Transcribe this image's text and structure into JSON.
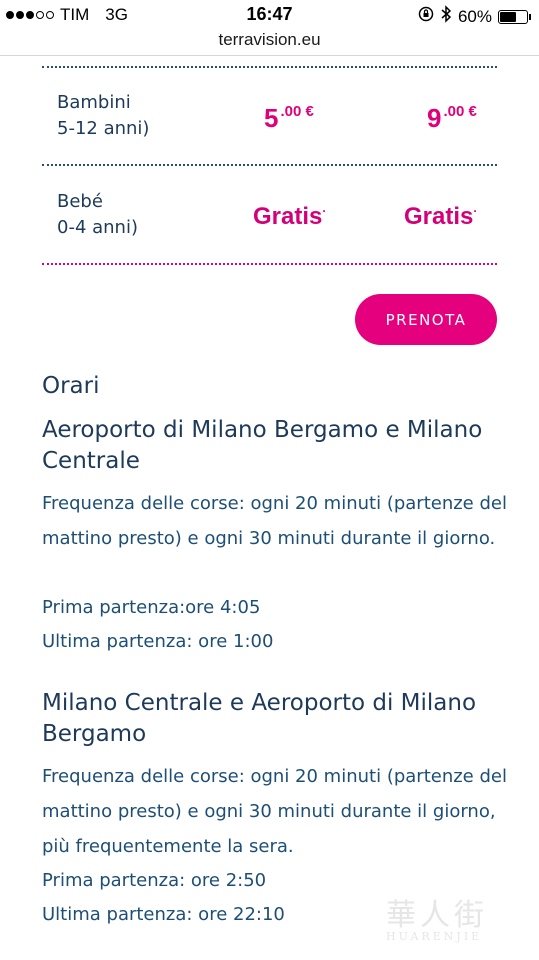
{
  "status_bar": {
    "carrier": "TIM",
    "network": "3G",
    "time": "16:47",
    "battery_percent": "60%",
    "battery_level": 0.6,
    "signal_bars_filled": 3,
    "signal_bars_total": 5
  },
  "browser": {
    "url": "terravision.eu"
  },
  "prices": {
    "rows": [
      {
        "label_line1": "Bambini",
        "label_line2": "5-12 anni)",
        "price1_int": "5",
        "price1_cents": ".00 €",
        "price2_int": "9",
        "price2_cents": ".00 €"
      },
      {
        "label_line1": "Bebé",
        "label_line2": "0-4 anni)",
        "price1": "Gratis",
        "price2": "Gratis",
        "mark": "·"
      }
    ],
    "colors": {
      "accent": "#e0007a",
      "text": "#1d3a5a"
    }
  },
  "book_button": {
    "label": "PRENOTA"
  },
  "timetable": {
    "heading": "Orari",
    "routes": [
      {
        "title": "Aeroporto di Milano Bergamo e Milano Centrale",
        "frequency": "Frequenza delle corse: ogni 20 minuti (partenze del mattino presto) e ogni 30 minuti durante il giorno.",
        "first": "Prima partenza:ore 4:05",
        "last": "Ultima partenza: ore 1:00"
      },
      {
        "title": "Milano Centrale e Aeroporto di Milano Bergamo",
        "frequency": "Frequenza delle corse: ogni 20 minuti (partenze del mattino presto) e ogni 30 minuti durante il giorno, più frequentemente la sera.",
        "first": "Prima partenza: ore 2:50",
        "last": "Ultima partenza: ore 22:10"
      }
    ]
  },
  "watermark": {
    "script": "華人街",
    "text": "HUARENJIE"
  }
}
